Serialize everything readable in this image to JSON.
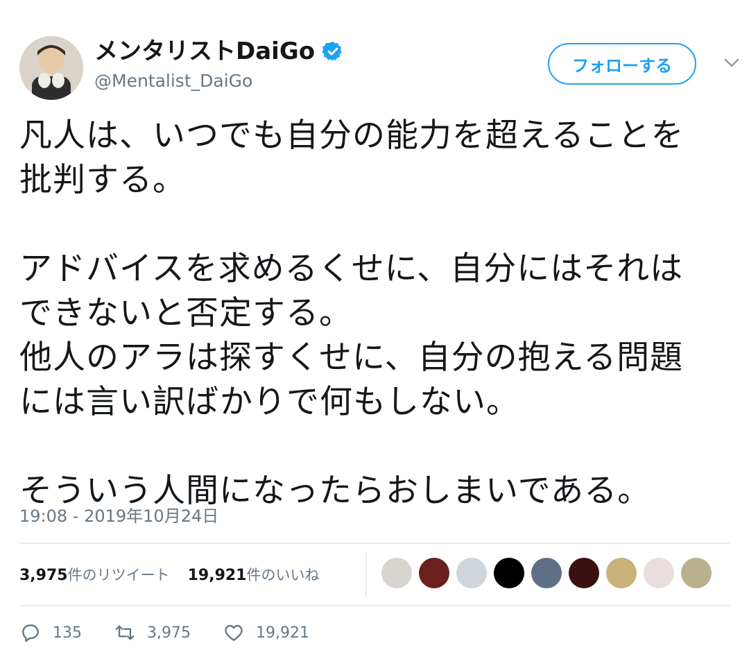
{
  "user": {
    "display_name": "メンタリストDaiGo",
    "handle": "@Mentalist_DaiGo",
    "verified_icon": "verified-badge-icon",
    "avatar_icon": "avatar-photo"
  },
  "follow_button": {
    "label": "フォローする",
    "color": "#1da1f2"
  },
  "menu_icon": "chevron-down-icon",
  "tweet": {
    "text": "凡人は、いつでも自分の能力を超えることを\n批判する。\n\nアドバイスを求めるくせに、自分にはそれは\nできないと否定する。\n他人のアラは探すくせに、自分の抱える問題\nには言い訳ばかりで何もしない。\n\nそういう人間になったらおしまいである。",
    "timestamp": "19:08 - 2019年10月24日"
  },
  "stats": {
    "retweets_count": "3,975",
    "retweets_label": "件のリツイート",
    "likes_count": "19,921",
    "likes_label": "件のいいね"
  },
  "liker_avatars": [
    {
      "icon": "liker-avatar-1",
      "color": "#d8d4cf"
    },
    {
      "icon": "liker-avatar-2",
      "color": "#6b1f1f"
    },
    {
      "icon": "liker-avatar-3",
      "color": "#cfd5db"
    },
    {
      "icon": "liker-avatar-4",
      "color": "#000000"
    },
    {
      "icon": "liker-avatar-5",
      "color": "#5e6f86"
    },
    {
      "icon": "liker-avatar-6",
      "color": "#3a1010"
    },
    {
      "icon": "liker-avatar-7",
      "color": "#c8b27a"
    },
    {
      "icon": "liker-avatar-8",
      "color": "#e9dede"
    },
    {
      "icon": "liker-avatar-9",
      "color": "#b9b08e"
    }
  ],
  "actions": {
    "reply_icon": "reply-icon",
    "reply_count": "135",
    "retweet_icon": "retweet-icon",
    "retweet_count": "3,975",
    "like_icon": "heart-icon",
    "like_count": "19,921"
  },
  "colors": {
    "accent": "#1da1f2",
    "secondary_text": "#657786",
    "divider": "#e6ecf0"
  }
}
